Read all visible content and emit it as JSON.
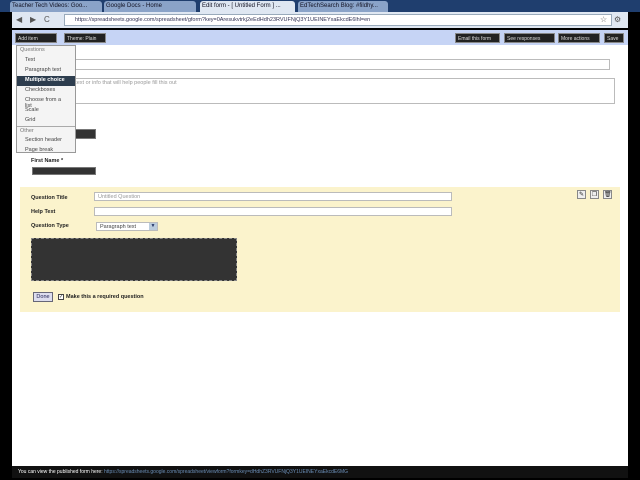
{
  "browser": {
    "tabs": [
      {
        "label": "Teacher Tech Videos: Goo..."
      },
      {
        "label": "Google Docs - Home"
      },
      {
        "label": "Edit form - [ Untitled Form ] ..."
      },
      {
        "label": "EdTechSearch Blog: #fildhy..."
      }
    ],
    "url": "https://spreadsheets.google.com/spreadsheet/gform?key=0Aresukvtrkj2eEdHdh23RVUFNjQ3Y1UEINEYxaEkcdE6lhl=en"
  },
  "toolbar": {
    "add_item": "Add item",
    "theme": "Theme: Plain",
    "email": "Email this form",
    "responses": "See responses",
    "more": "More actions",
    "save": "Save"
  },
  "menu": {
    "questions_header": "Questions",
    "items": [
      "Text",
      "Paragraph text",
      "Multiple choice",
      "Checkboxes",
      "Choose from a list",
      "Scale",
      "Grid"
    ],
    "selected": "Multiple choice",
    "other_header": "Other",
    "other_items": [
      "Section header",
      "Page break"
    ]
  },
  "form": {
    "description_placeholder": "...e text or info that will help people fill this out",
    "first_name_label": "First Name *"
  },
  "editor": {
    "question_title_label": "Question Title",
    "question_title_placeholder": "Untitled Question",
    "help_text_label": "Help Text",
    "question_type_label": "Question Type",
    "question_type_value": "Paragraph text",
    "done": "Done",
    "required_label": "Make this a required question",
    "required_checked": true
  },
  "footer": {
    "text": "You can view the published form here:",
    "link": "https://spreadsheets.google.com/spreadsheet/viewform?formkey=dHdhZ3RVUFNjQ3Y1UEINEYxaEkcdE6MG"
  }
}
